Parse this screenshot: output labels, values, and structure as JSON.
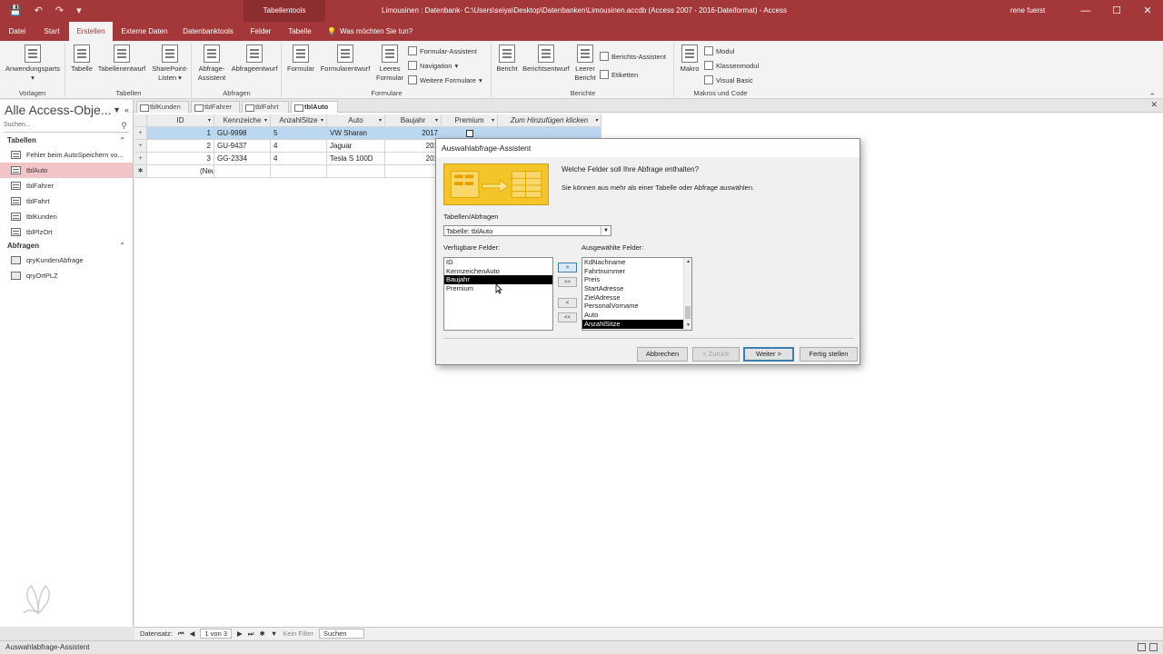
{
  "titlebar": {
    "context_tab": "Tabellentools",
    "title": "Limousinen : Datenbank- C:\\Users\\seiya\\Desktop\\Datenbanken\\Limousinen.accdb (Access 2007 - 2016-Dateiformat)  -  Access",
    "user": "rene fuerst",
    "minimize": "—",
    "maximize": "☐",
    "close": "✕"
  },
  "tabs": [
    "Datei",
    "Start",
    "Erstellen",
    "Externe Daten",
    "Datenbanktools",
    "Felder",
    "Tabelle"
  ],
  "tellme": "Was möchten Sie tun?",
  "ribbon": {
    "vorlagen": {
      "label": "Vorlagen",
      "btn": "Anwendungsparts"
    },
    "tabellen": {
      "label": "Tabellen",
      "btn1": "Tabelle",
      "btn2": "Tabellenentwurf",
      "btn3": "SharePoint-Listen"
    },
    "abfragen": {
      "label": "Abfragen",
      "btn1": "Abfrage-Assistent",
      "btn2": "Abfrageentwurf"
    },
    "formulare": {
      "label": "Formulare",
      "btn1": "Formular",
      "btn2": "Formularentwurf",
      "btn3": "Leeres Formular",
      "s1": "Formular-Assistent",
      "s2": "Navigation",
      "s3": "Weitere Formulare"
    },
    "berichte": {
      "label": "Berichte",
      "btn1": "Bericht",
      "btn2": "Berichtsentwurf",
      "btn3": "Leerer Bericht",
      "s1": "Berichts-Assistent",
      "s2": "Etiketten"
    },
    "makros": {
      "label": "Makros und Code",
      "btn1": "Makro",
      "s1": "Modul",
      "s2": "Klassenmodul",
      "s3": "Visual Basic"
    }
  },
  "nav": {
    "title": "Alle Access-Obje...",
    "search_placeholder": "Suchen...",
    "sec_tables": "Tabellen",
    "tables": [
      "Fehler beim AutoSpeichern vo...",
      "tblAuto",
      "tblFahrer",
      "tblFahrt",
      "tblKunden",
      "tblPlzOrt"
    ],
    "sec_queries": "Abfragen",
    "queries": [
      "qryKundenAbfrage",
      "qryOrtPLZ"
    ]
  },
  "doctabs": [
    "tblKunden",
    "tblFahrer",
    "tblFahrt",
    "tblAuto"
  ],
  "grid": {
    "headers": [
      "ID",
      "Kennzeiche",
      "AnzahlSitze",
      "Auto",
      "Baujahr",
      "Premium",
      "Zum Hinzufügen klicken"
    ],
    "rows": [
      [
        "1",
        "GU-9998",
        "5",
        "VW Sharan",
        "2017"
      ],
      [
        "2",
        "GU-9437",
        "4",
        "Jaguar",
        "201"
      ],
      [
        "3",
        "GG-2334",
        "4",
        "Tesla S 100D",
        "201"
      ]
    ],
    "new_row": "(Neu)"
  },
  "recnav": {
    "label": "Datensatz:",
    "position": "1 von 3",
    "filter": "Kein Filter",
    "search": "Suchen"
  },
  "statusbar": "Auswahlabfrage-Assistent",
  "dialog": {
    "title": "Auswahlabfrage-Assistent",
    "question": "Welche Felder soll Ihre Abfrage enthalten?",
    "hint": "Sie können aus mehr als einer Tabelle oder Abfrage auswählen.",
    "tables_label": "Tabellen/Abfragen",
    "tables_value": "Tabelle: tblAuto",
    "available_label": "Verfügbare Felder:",
    "available": [
      "ID",
      "KennzeichenAuto",
      "Baujahr",
      "Premium"
    ],
    "selected_label": "Ausgewählte Felder:",
    "selected": [
      "KdNachname",
      "Fahrtnummer",
      "Preis",
      "StartAdresse",
      "ZielAdresse",
      "PersonalVorname",
      "Auto",
      "AnzahlSitze"
    ],
    "move_buttons": [
      ">",
      ">>",
      "<",
      "<<"
    ],
    "btn_cancel": "Abbrechen",
    "btn_back": "< Zurück",
    "btn_next": "Weiter >",
    "btn_finish": "Fertig stellen"
  },
  "colors": {
    "accent": "#a4373a",
    "selection": "#bcd7f0",
    "nav_selection": "#f2c4c8",
    "banner": "#f4c428"
  }
}
